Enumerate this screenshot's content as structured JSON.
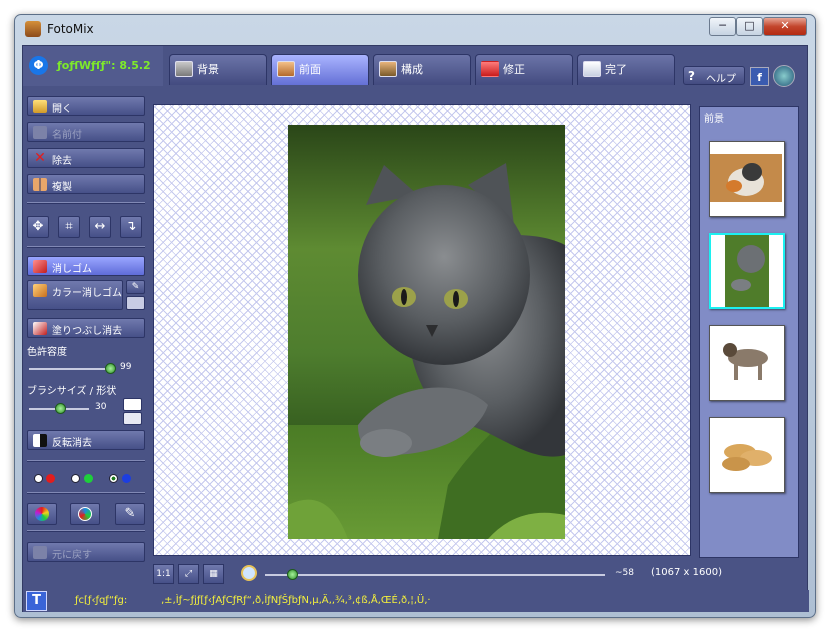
{
  "window": {
    "title": "FotoMix",
    "controls": [
      "─",
      "□",
      "✕"
    ]
  },
  "app": {
    "logo_text": "ƒoƒſWƒſƒ\": 8.5.2"
  },
  "tabs": [
    {
      "label": "背景",
      "active": false
    },
    {
      "label": "前面",
      "active": true
    },
    {
      "label": "構成",
      "active": false
    },
    {
      "label": "修正",
      "active": false
    },
    {
      "label": "完了",
      "active": false
    }
  ],
  "header_right": {
    "help_label": "ヘルプ",
    "help_icon": "?",
    "facebook": "f"
  },
  "left": {
    "open": "開く",
    "save_disabled": "名前付",
    "remove": "除去",
    "duplicate": "複製",
    "eraser": "消しゴム",
    "color_eraser": "カラー消しゴム",
    "fill_erase": "塗りつぶし消去",
    "color_tolerance_label": "色許容度",
    "color_tolerance_value": "99",
    "brush_label": "ブラシサイズ / 形状",
    "brush_value": "30",
    "invert_erase": "反転消去",
    "undo_disabled": "元に戻す"
  },
  "right": {
    "title": "前景"
  },
  "bottom": {
    "zoom_value": "58",
    "zoom_tick": "~58",
    "dimensions": "(1067 x 1600)",
    "fit_label": "1:1"
  },
  "status": {
    "label": "ƒc[ƒ‹ƒqƒ“ƒg:",
    "text": "‚±‚Ìƒ~ƒjƒ[ƒ‹ƒAƒCƒRƒ“‚ð‚ÌƒNƒŠƒbƒN‚µ‚Ä‚­‚¾‚³‚¢ß‚Å‚ŒÉ‚ð‚¦‚Ü‚·",
    "t_icon": "T"
  },
  "colors": {
    "accent": "#4a5385",
    "tab_active": "#7b86e8",
    "logo": "#7eea2a",
    "status_text": "#f4f03c"
  }
}
